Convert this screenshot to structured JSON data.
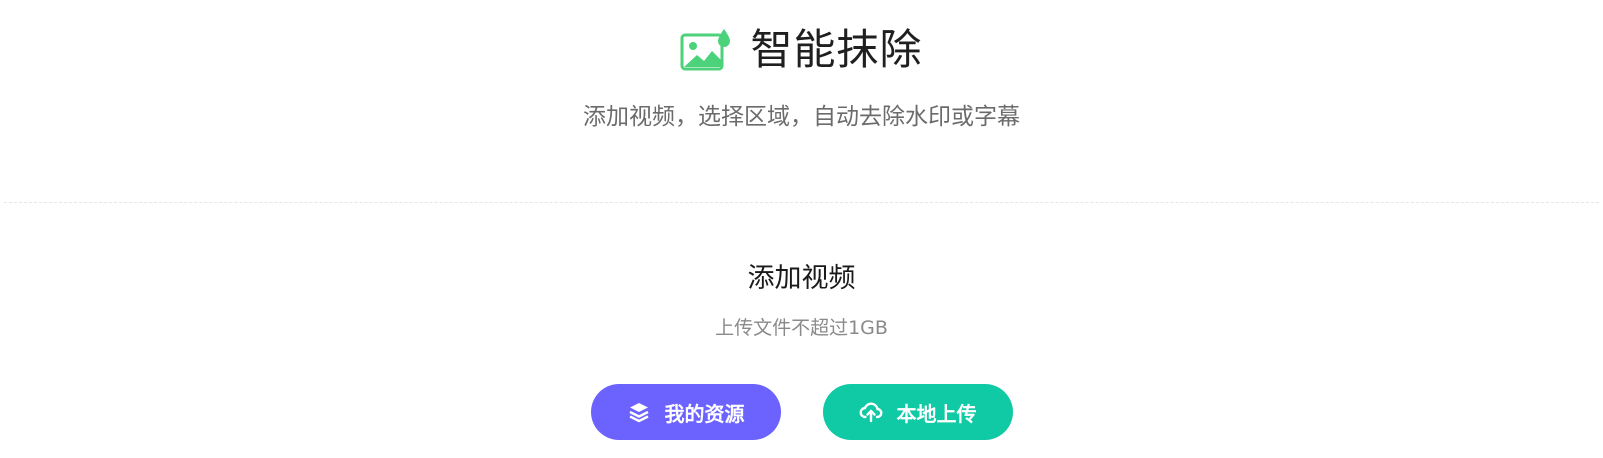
{
  "header": {
    "title": "智能抹除",
    "subtitle": "添加视频，选择区域，自动去除水印或字幕",
    "icon": "image-drop-icon",
    "icon_color": "#4cd27a"
  },
  "upload": {
    "title": "添加视频",
    "hint": "上传文件不超过1GB"
  },
  "buttons": {
    "resources_label": "我的资源",
    "resources_icon": "layers-icon",
    "resources_color": "#6c63ff",
    "upload_label": "本地上传",
    "upload_icon": "cloud-upload-icon",
    "upload_color": "#10c9a5"
  }
}
